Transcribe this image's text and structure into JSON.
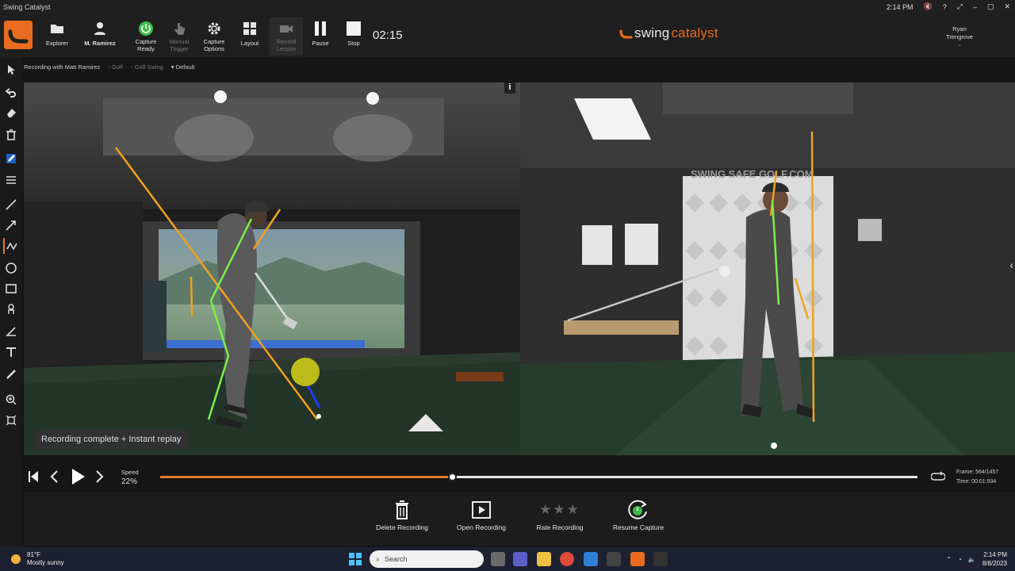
{
  "window": {
    "title": "Swing Catalyst",
    "clock": "2:14 PM"
  },
  "toolbar": {
    "explorer": "Explorer",
    "athlete": "M. Ramirez",
    "capture_ready": "Capture\nReady",
    "capture_ready_l1": "Capture",
    "capture_ready_l2": "Ready",
    "manual_trigger_l1": "Manual",
    "manual_trigger_l2": "Trigger",
    "capture_options_l1": "Capture",
    "capture_options_l2": "Options",
    "layout": "Layout",
    "record_lesson_l1": "Record",
    "record_lesson_l2": "Lesson",
    "pause": "Pause",
    "stop": "Stop",
    "timer": "02:15",
    "brand_prefix": "swing",
    "brand_suffix": "catalyst",
    "user_first": "Ryan",
    "user_last": "Trengrove"
  },
  "breadcrumb": {
    "recording_with": "Recording with Matt Ramirez",
    "sport": "Golf",
    "category": "Golf Swing",
    "preset": "Default"
  },
  "video": {
    "overlay_label": "Recording complete + Instant replay",
    "wall_sign": "SWING SAFE GOLF.COM"
  },
  "player": {
    "speed_label": "Speed",
    "speed_value": "22%",
    "frame": "Frame: 564/1457",
    "time": "Time: 00:01:934",
    "progress": 0.385
  },
  "actions": {
    "delete": "Delete Recording",
    "open": "Open Recording",
    "rate": "Rate Recording",
    "resume": "Resume Capture",
    "stars": "★★★"
  },
  "taskbar": {
    "temp": "81°F",
    "weather": "Mostly sunny",
    "search_placeholder": "Search",
    "time": "2:14 PM",
    "date": "8/8/2023"
  },
  "colors": {
    "accent": "#e57b2c",
    "green_line": "#7cf04a",
    "orange_line": "#f0a21e"
  }
}
